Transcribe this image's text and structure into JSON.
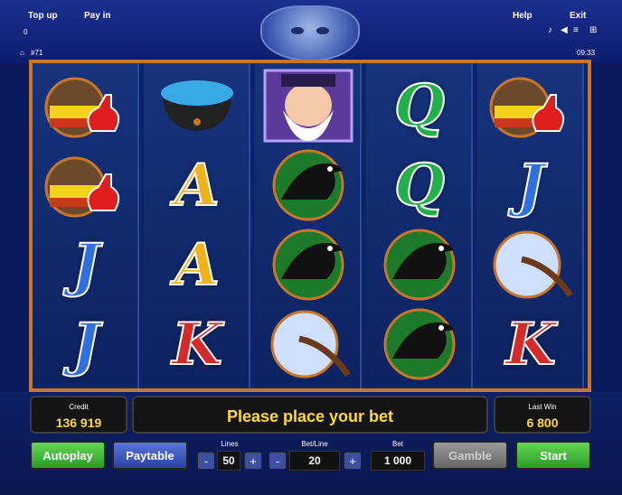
{
  "header": {
    "top_up": "Top up",
    "pay_in": "Pay in",
    "help": "Help",
    "exit": "Exit",
    "left_value": "0",
    "round": "#71",
    "time": "09:33"
  },
  "reels": [
    [
      "Potions",
      "Potions",
      "J",
      "J"
    ],
    [
      "Cauldron",
      "A",
      "A",
      "K"
    ],
    [
      "Wizard",
      "Raven",
      "Raven",
      "Moon"
    ],
    [
      "Q",
      "Q",
      "Raven",
      "Raven"
    ],
    [
      "Potions",
      "J",
      "Moon",
      "K"
    ]
  ],
  "colors": {
    "J": "#2f6fe0",
    "Q": "#23b04a",
    "A": "#f0b21a",
    "K": "#d42a2a",
    "accent": "#c8762a"
  },
  "status": {
    "credit_label": "Credit",
    "credit_value": "136 919",
    "message": "Please place your bet",
    "last_win_label": "Last Win",
    "last_win_value": "6 800"
  },
  "controls": {
    "autoplay": "Autoplay",
    "paytable": "Paytable",
    "lines_label": "Lines",
    "lines_value": "50",
    "betline_label": "Bet/Line",
    "betline_value": "20",
    "bet_label": "Bet",
    "bet_value": "1 000",
    "gamble": "Gamble",
    "start": "Start",
    "minus": "-",
    "plus": "+"
  }
}
